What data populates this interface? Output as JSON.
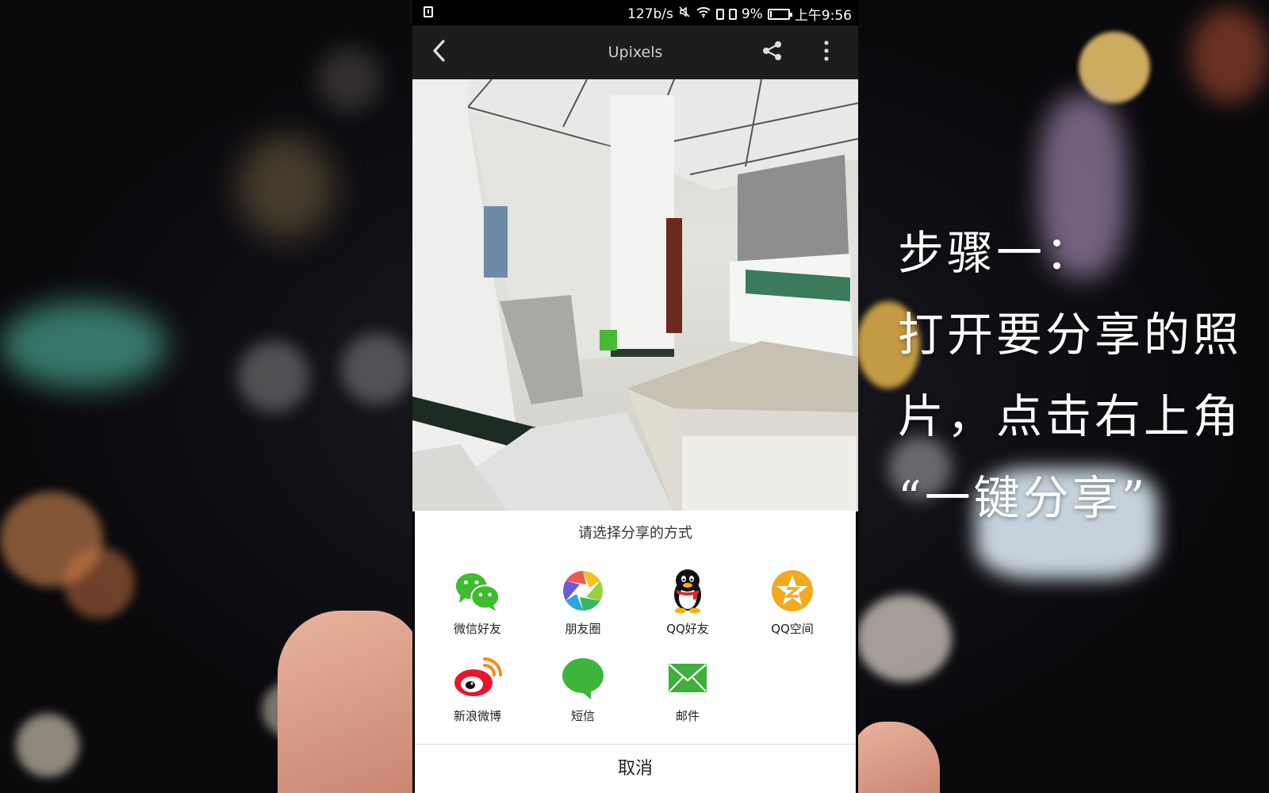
{
  "status_bar": {
    "net_speed": "127b/s",
    "battery_percent": "9%",
    "time": "上午9:56",
    "battery_level": 0.09
  },
  "toolbar": {
    "title": "Upixels",
    "back_icon": "chevron-left-icon",
    "share_icon": "share-icon",
    "more_icon": "more-vertical-icon"
  },
  "share_sheet": {
    "title": "请选择分享的方式",
    "items": [
      {
        "label": "微信好友",
        "icon": "wechat-icon"
      },
      {
        "label": "朋友圈",
        "icon": "moments-icon"
      },
      {
        "label": "QQ好友",
        "icon": "qq-icon"
      },
      {
        "label": "QQ空间",
        "icon": "qzone-icon"
      },
      {
        "label": "新浪微博",
        "icon": "weibo-icon"
      },
      {
        "label": "短信",
        "icon": "sms-icon"
      },
      {
        "label": "邮件",
        "icon": "mail-icon"
      }
    ],
    "cancel_label": "取消"
  },
  "caption": {
    "line1": "步骤一：",
    "line2": "打开要分享的照",
    "line3": "片，点击右上角",
    "line4": "“一键分享”"
  },
  "colors": {
    "wechat": "#3ebb2e",
    "qzone": "#f3a91d",
    "weibo": "#e6162d",
    "sms": "#3eb53a",
    "mail": "#3fae3a"
  }
}
